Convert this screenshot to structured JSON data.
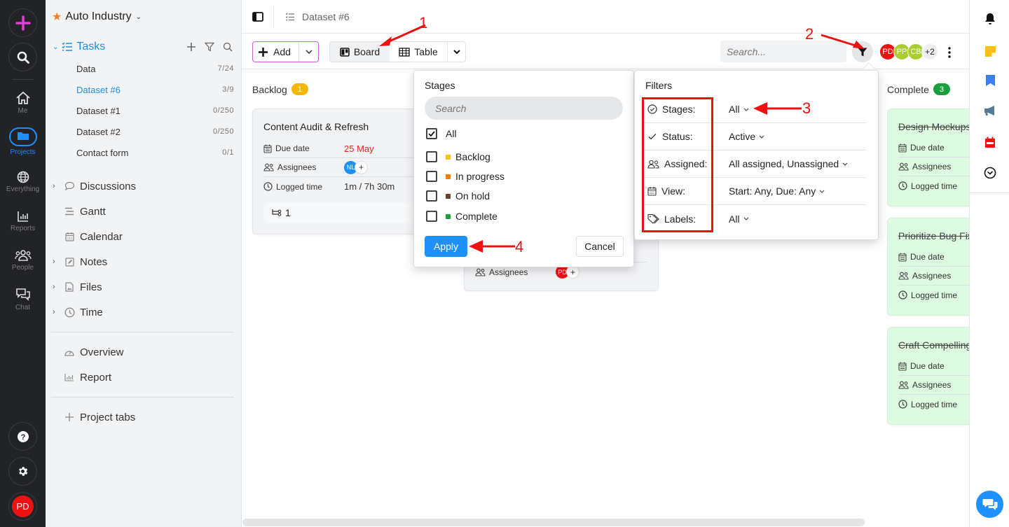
{
  "rail": {
    "new_label": "New",
    "items": [
      {
        "label": "Me",
        "icon": "home-icon"
      },
      {
        "label": "Projects",
        "icon": "folder-icon"
      },
      {
        "label": "Everything",
        "icon": "globe-icon"
      },
      {
        "label": "Reports",
        "icon": "chart-icon"
      },
      {
        "label": "People",
        "icon": "people-icon"
      },
      {
        "label": "Chat",
        "icon": "chat-icon"
      }
    ],
    "user_initials": "PD"
  },
  "sidebar": {
    "project_title": "Auto Industry",
    "tasks_label": "Tasks",
    "task_lists": [
      {
        "label": "Data",
        "count": "7/24"
      },
      {
        "label": "Dataset #6",
        "count": "3/9"
      },
      {
        "label": "Dataset #1",
        "count": "0/250"
      },
      {
        "label": "Dataset #2",
        "count": "0/250"
      },
      {
        "label": "Contact form",
        "count": "0/1"
      }
    ],
    "nav": [
      {
        "label": "Discussions"
      },
      {
        "label": "Gantt"
      },
      {
        "label": "Calendar"
      },
      {
        "label": "Notes"
      },
      {
        "label": "Files"
      },
      {
        "label": "Time"
      }
    ],
    "extra": [
      {
        "label": "Overview"
      },
      {
        "label": "Report"
      }
    ],
    "project_tabs_label": "Project tabs"
  },
  "topbar": {
    "breadcrumb": "Dataset #6"
  },
  "toolbar": {
    "add_label": "Add",
    "views": [
      {
        "label": "Board"
      },
      {
        "label": "Table"
      }
    ],
    "active_view": "Board",
    "search_placeholder": "Search...",
    "members": [
      {
        "initials": "PD",
        "color": "#ee1111"
      },
      {
        "initials": "PP",
        "color": "#a8cf2e"
      },
      {
        "initials": "CB",
        "color": "#a8cf2e"
      }
    ],
    "members_more": "+2"
  },
  "board": {
    "columns": [
      {
        "name": "Backlog",
        "count": "1",
        "color": "#f5b800"
      },
      {
        "name": "Complete",
        "count": "3",
        "color": "#1c9e3f"
      }
    ],
    "backlog_card": {
      "title": "Content Audit & Refresh",
      "due_label": "Due date",
      "due_value": "25 May",
      "assignees_label": "Assignees",
      "assignee": "NL",
      "logged_label": "Logged time",
      "logged_value": "1m / 7h 30m",
      "subtasks": "1"
    },
    "hidden_card": {
      "assignees_label": "Assignees",
      "assignee": "PD"
    },
    "complete_cards": [
      {
        "title": "Design Mockups",
        "due_label": "Due date",
        "assignees_label": "Assignees",
        "logged_label": "Logged time"
      },
      {
        "title": "Prioritize Bug Fixes",
        "due_label": "Due date",
        "assignees_label": "Assignees",
        "logged_label": "Logged time"
      },
      {
        "title": "Craft Compelling",
        "due_label": "Due date",
        "assignees_label": "Assignees",
        "logged_label": "Logged time"
      }
    ]
  },
  "stages_popup": {
    "title": "Stages",
    "search_placeholder": "Search",
    "all_label": "All",
    "all_checked": true,
    "options": [
      {
        "label": "Backlog",
        "color": "#f5c000",
        "checked": false
      },
      {
        "label": "In progress",
        "color": "#f57c00",
        "checked": false
      },
      {
        "label": "On hold",
        "color": "#6b3f2e",
        "checked": false
      },
      {
        "label": "Complete",
        "color": "#1c9e3f",
        "checked": false
      }
    ],
    "apply_label": "Apply",
    "cancel_label": "Cancel"
  },
  "filters_popup": {
    "title": "Filters",
    "rows": [
      {
        "key": "Stages:",
        "value": "All",
        "icon": "circle-check-icon"
      },
      {
        "key": "Status:",
        "value": "Active",
        "icon": "check-icon"
      },
      {
        "key": "Assigned:",
        "value": "All assigned, Unassigned",
        "icon": "people-icon"
      },
      {
        "key": "View:",
        "value": "Start: Any, Due: Any",
        "icon": "calendar-icon"
      },
      {
        "key": "Labels:",
        "value": "All",
        "icon": "tag-icon"
      }
    ]
  },
  "annotations": [
    "1",
    "2",
    "3",
    "4"
  ],
  "colors": {
    "accent": "#1e90ff",
    "rail_bg": "#222327",
    "annotation": "#ee1111"
  }
}
